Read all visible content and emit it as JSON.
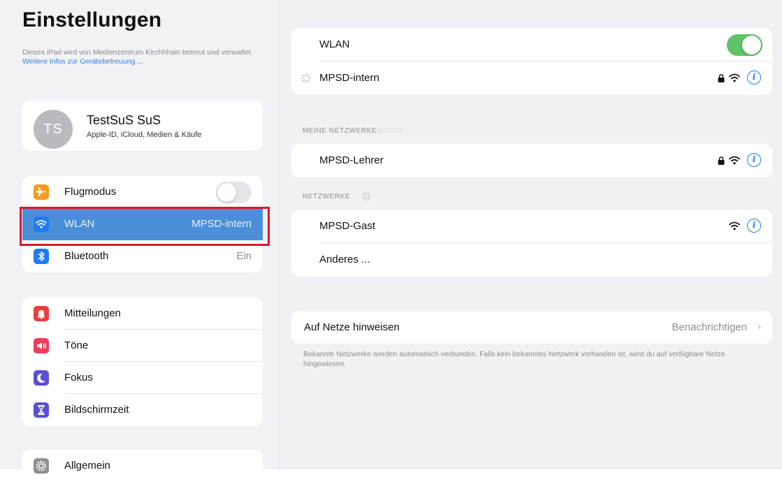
{
  "sidebar": {
    "title": "Einstellungen",
    "managed_text": "Dieses iPad wird von Medienzentrum Kirchhhain betreut und verwaltet.",
    "managed_link": "Weitere Infos zur Gerätebetreuung ...",
    "profile": {
      "initials": "TS",
      "name": "TestSuS SuS",
      "subtitle": "Apple-ID, iCloud, Medien & Käufe"
    },
    "group1": [
      {
        "label": "Flugmodus",
        "icon": "airplane-icon",
        "color": "#f59a23",
        "toggle": false
      },
      {
        "label": "WLAN",
        "value": "MPSD-intern",
        "icon": "wifi-icon",
        "color": "#1e7cf0",
        "selected": true
      },
      {
        "label": "Bluetooth",
        "value": "Ein",
        "icon": "bluetooth-icon",
        "color": "#1e7cf0"
      }
    ],
    "group2": [
      {
        "label": "Mitteilungen",
        "icon": "bell-icon",
        "color": "#ef3b3b"
      },
      {
        "label": "Töne",
        "icon": "speaker-icon",
        "color": "#ef3b5a"
      },
      {
        "label": "Fokus",
        "icon": "moon-icon",
        "color": "#5b4fd6"
      },
      {
        "label": "Bildschirmzeit",
        "icon": "hourglass-icon",
        "color": "#5b4fd6"
      }
    ],
    "group3": [
      {
        "label": "Allgemein",
        "icon": "gear-icon",
        "color": "#8e8e93"
      }
    ]
  },
  "main": {
    "wlan": {
      "label": "WLAN",
      "enabled": true,
      "toggle_color": "#5ec26a"
    },
    "connecting_network": {
      "name": "MPSD-intern",
      "secured": true
    },
    "my_networks_header": "MEINE NETZWERKE",
    "my_networks_header_faded": "SPOTS",
    "my_networks": [
      {
        "name": "MPSD-Lehrer",
        "secured": true
      }
    ],
    "networks_header": "NETZWERKE",
    "networks": [
      {
        "name": "MPSD-Gast",
        "secured": false
      },
      {
        "name": "Anderes ..."
      }
    ],
    "ask_to_join": {
      "label": "Auf Netze hinweisen",
      "value": "Benachrichtigen"
    },
    "footer_note": "Bekannte Netzwerke werden automatisch verbunden. Falls kein bekanntes Netzwerk vorhanden ist, wirst du auf verfügbare Netze hingewiesen.",
    "accent": "#1e7cf0"
  }
}
